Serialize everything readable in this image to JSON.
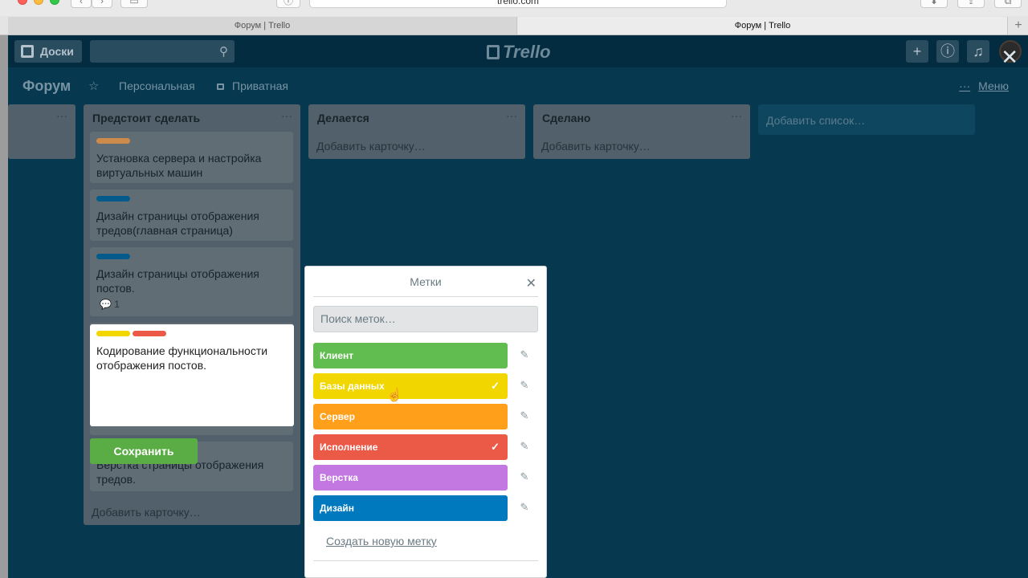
{
  "browser": {
    "url": "trello.com",
    "tabs": [
      {
        "title": "Форум | Trello"
      },
      {
        "title": "Форум | Trello"
      }
    ],
    "new_tab": "+"
  },
  "header": {
    "boards_label": "Доски",
    "logo": "Trello",
    "icons": [
      "boards-icon",
      "search-icon",
      "plus-icon",
      "info-icon",
      "bell-icon"
    ]
  },
  "board": {
    "title": "Форум",
    "team": "Персональная",
    "visibility": "Приватная",
    "menu_label": "Меню",
    "dots": "···"
  },
  "lists": [
    {
      "title": "Предстоит сделать",
      "cards": [
        {
          "labels": [
            "#cd8b4b"
          ],
          "text": "Установка сервера и настройка виртуальных машин"
        },
        {
          "labels": [
            "#055a8c"
          ],
          "text": "Дизайн страницы отображения тредов(главная страница)"
        },
        {
          "labels": [
            "#055a8c"
          ],
          "text": "Дизайн страницы отображения постов.",
          "comments": "1"
        },
        {
          "labels": [
            "#f2d600",
            "#eb5a46"
          ],
          "text": "Кодирование функциональности отображения постов."
        },
        {
          "labels": [],
          "text": "Верстка страницы отображения тредов."
        }
      ],
      "add_card": "Добавить карточку…"
    },
    {
      "title": "Делается",
      "add_card": "Добавить карточку…"
    },
    {
      "title": "Сделано",
      "add_card": "Добавить карточку…"
    }
  ],
  "add_list": "Добавить список…",
  "editor": {
    "text": "Кодирование функциональности отображения постов.",
    "save_label": "Сохранить"
  },
  "labels_popover": {
    "title": "Метки",
    "search_placeholder": "Поиск меток…",
    "labels": [
      {
        "name": "Клиент",
        "color": "#61bd4f",
        "checked": false
      },
      {
        "name": "Базы данных",
        "color": "#f2d600",
        "checked": true
      },
      {
        "name": "Сервер",
        "color": "#ff9f1a",
        "checked": false
      },
      {
        "name": "Исполнение",
        "color": "#eb5a46",
        "checked": true
      },
      {
        "name": "Верстка",
        "color": "#c377e0",
        "checked": false
      },
      {
        "name": "Дизайн",
        "color": "#0079bf",
        "checked": false
      }
    ],
    "create_label": "Создать новую метку"
  }
}
